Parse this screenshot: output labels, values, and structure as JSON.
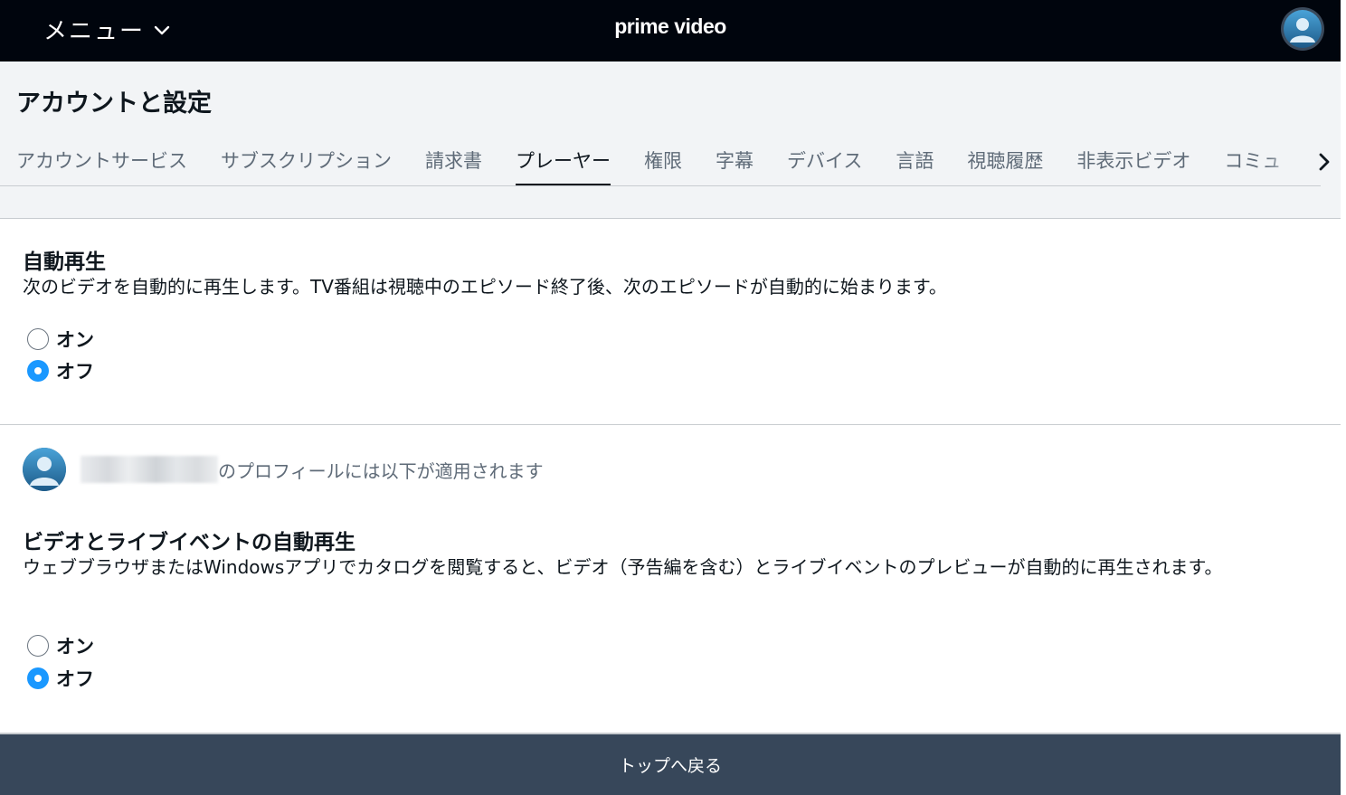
{
  "topbar": {
    "menu_label": "メニュー",
    "logo": "prime video",
    "menu_icon": "chevron-down-icon",
    "avatar_icon": "user-avatar-icon",
    "background": "#00050d"
  },
  "header": {
    "title": "アカウントと設定",
    "tabs": [
      {
        "label": "アカウントサービス",
        "active": false
      },
      {
        "label": "サブスクリプション",
        "active": false
      },
      {
        "label": "請求書",
        "active": false
      },
      {
        "label": "プレーヤー",
        "active": true
      },
      {
        "label": "権限",
        "active": false
      },
      {
        "label": "字幕",
        "active": false
      },
      {
        "label": "デバイス",
        "active": false
      },
      {
        "label": "言語",
        "active": false
      },
      {
        "label": "視聴履歴",
        "active": false
      },
      {
        "label": "非表示ビデオ",
        "active": false
      },
      {
        "label": "コミュ",
        "active": false
      }
    ],
    "next_icon": "chevron-right-icon"
  },
  "autoplay": {
    "title": "自動再生",
    "description": "次のビデオを自動的に再生します。TV番組は視聴中のエピソード終了後、次のエピソードが自動的に始まります。",
    "options": [
      {
        "label": "オン",
        "selected": false
      },
      {
        "label": "オフ",
        "selected": true
      }
    ]
  },
  "profile": {
    "suffix_text": "のプロフィールには以下が適用されます"
  },
  "preview_autoplay": {
    "title": "ビデオとライブイベントの自動再生",
    "description": "ウェブブラウザまたはWindowsアプリでカタログを閲覧すると、ビデオ（予告編を含む）とライブイベントのプレビューが自動的に再生されます。",
    "options": [
      {
        "label": "オン",
        "selected": false
      },
      {
        "label": "オフ",
        "selected": true
      }
    ]
  },
  "footer": {
    "back_to_top": "トップへ戻る",
    "background": "#37475a"
  },
  "colors": {
    "accent": "#1a98ff",
    "header_bg": "#f2f4f6"
  }
}
